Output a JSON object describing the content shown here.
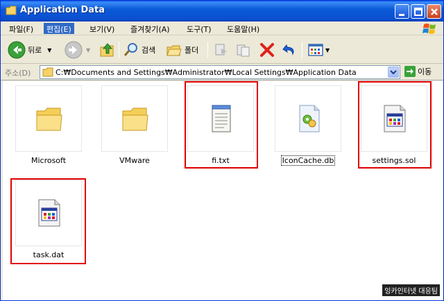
{
  "window": {
    "title": "Application Data"
  },
  "menu": [
    {
      "label": "파일(F)",
      "active": false
    },
    {
      "label": "편집(E)",
      "active": true
    },
    {
      "label": "보기(V)",
      "active": false
    },
    {
      "label": "즐겨찾기(A)",
      "active": false
    },
    {
      "label": "도구(T)",
      "active": false
    },
    {
      "label": "도움말(H)",
      "active": false
    }
  ],
  "toolbar": {
    "back_label": "뒤로",
    "search_label": "검색",
    "folders_label": "폴더"
  },
  "address": {
    "label": "주소(D)",
    "path": "C:₩Documents and Settings₩Administrator₩Local Settings₩Application Data",
    "go_label": "이동"
  },
  "files": [
    {
      "name": "Microsoft",
      "type": "folder",
      "highlighted": false
    },
    {
      "name": "VMware",
      "type": "folder",
      "highlighted": false
    },
    {
      "name": "fi.txt",
      "type": "text",
      "highlighted": true
    },
    {
      "name": "IconCache.db",
      "type": "db",
      "highlighted": false,
      "selected": true
    },
    {
      "name": "settings.sol",
      "type": "app",
      "highlighted": true
    },
    {
      "name": "task.dat",
      "type": "app",
      "highlighted": true
    }
  ],
  "watermark": "잉카인터넷 대응팀",
  "colors": {
    "titlebar": "#0a52d8",
    "highlight": "#e00000",
    "menu_active": "#316ac5"
  }
}
